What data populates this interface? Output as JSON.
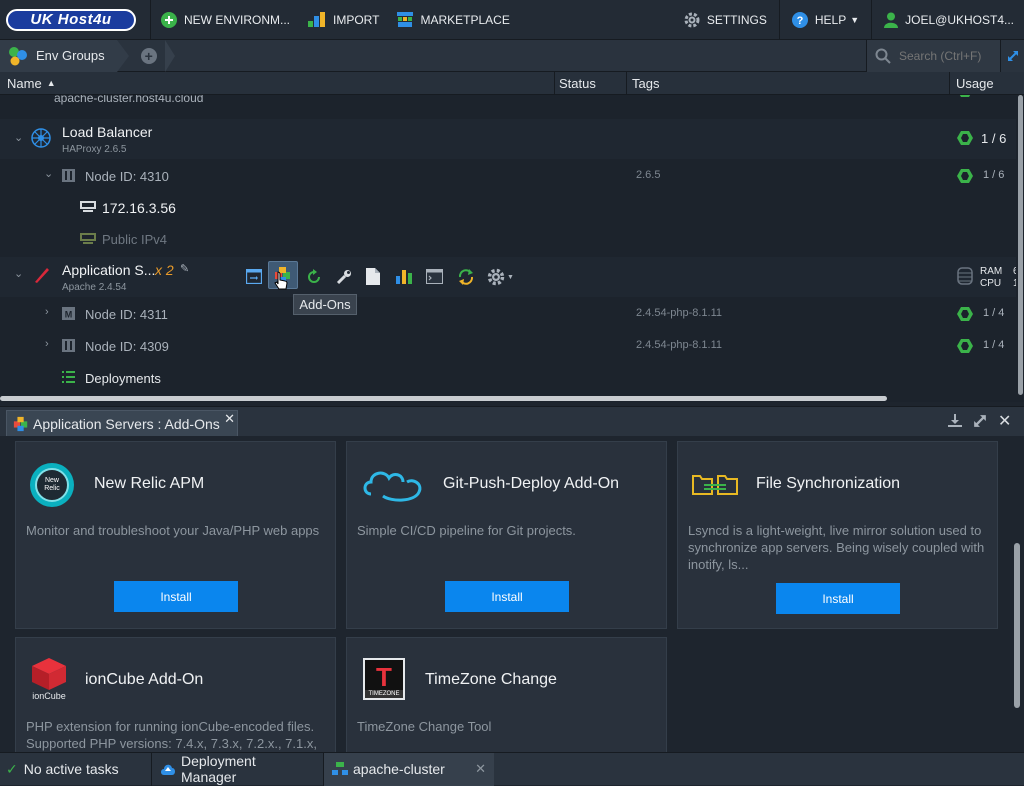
{
  "topbar": {
    "logo_text": "UK Host4u",
    "new_env_label": "NEW ENVIRONM...",
    "import_label": "IMPORT",
    "marketplace_label": "MARKETPLACE",
    "settings_label": "SETTINGS",
    "help_label": "HELP",
    "user_label": "JOEL@UKHOST4..."
  },
  "envbar": {
    "env_groups_label": "Env Groups",
    "search_placeholder": "Search (Ctrl+F)"
  },
  "columns": {
    "name": "Name",
    "status": "Status",
    "tags": "Tags",
    "usage": "Usage"
  },
  "tree": {
    "env_domain": "apache-cluster.host4u.cloud",
    "load_balancer": {
      "title": "Load Balancer",
      "subtitle": "HAProxy 2.6.5",
      "usage": "1 / 6",
      "node": {
        "label": "Node ID: 4310",
        "tag": "2.6.5",
        "usage": "1 / 6"
      },
      "ip": "172.16.3.56",
      "public_ip": "Public IPv4"
    },
    "app_server": {
      "title": "Application S...",
      "count": "x 2",
      "subtitle": "Apache 2.4.54",
      "ram_label": "RAM",
      "cpu_label": "CPU",
      "ram_value": "6",
      "cpu_value": "1",
      "tooltip": "Add-Ons",
      "nodes": [
        {
          "label": "Node ID: 4311",
          "tag": "2.4.54-php-8.1.11",
          "usage": "1 / 4"
        },
        {
          "label": "Node ID: 4309",
          "tag": "2.4.54-php-8.1.11",
          "usage": "1 / 4"
        }
      ],
      "deployments": "Deployments"
    }
  },
  "panel": {
    "tab_label": "Application Servers : Add-Ons",
    "cards": [
      {
        "title": "New Relic APM",
        "desc": "Monitor and troubleshoot your Java/PHP web apps",
        "button": "Install",
        "icon_text": "New Relic"
      },
      {
        "title": "Git-Push-Deploy Add-On",
        "desc": "Simple CI/CD pipeline for Git projects.",
        "button": "Install"
      },
      {
        "title": "File Synchronization",
        "desc": "Lsyncd is a light-weight, live mirror solution used to synchronize app servers. Being wisely coupled with inotify, ls...",
        "button": "Install"
      },
      {
        "title": "ionCube Add-On",
        "desc": "PHP extension for running ionCube-encoded files. Supported PHP versions: 7.4.x, 7.3.x, 7.2.x., 7.1.x,",
        "icon_text": "ionCube"
      },
      {
        "title": "TimeZone Change",
        "desc": "TimeZone Change Tool",
        "icon_text": "TIMEZONE"
      }
    ]
  },
  "statusbar": {
    "tasks_label": "No active tasks",
    "deploy_label": "Deployment Manager",
    "env_tab_label": "apache-cluster"
  }
}
